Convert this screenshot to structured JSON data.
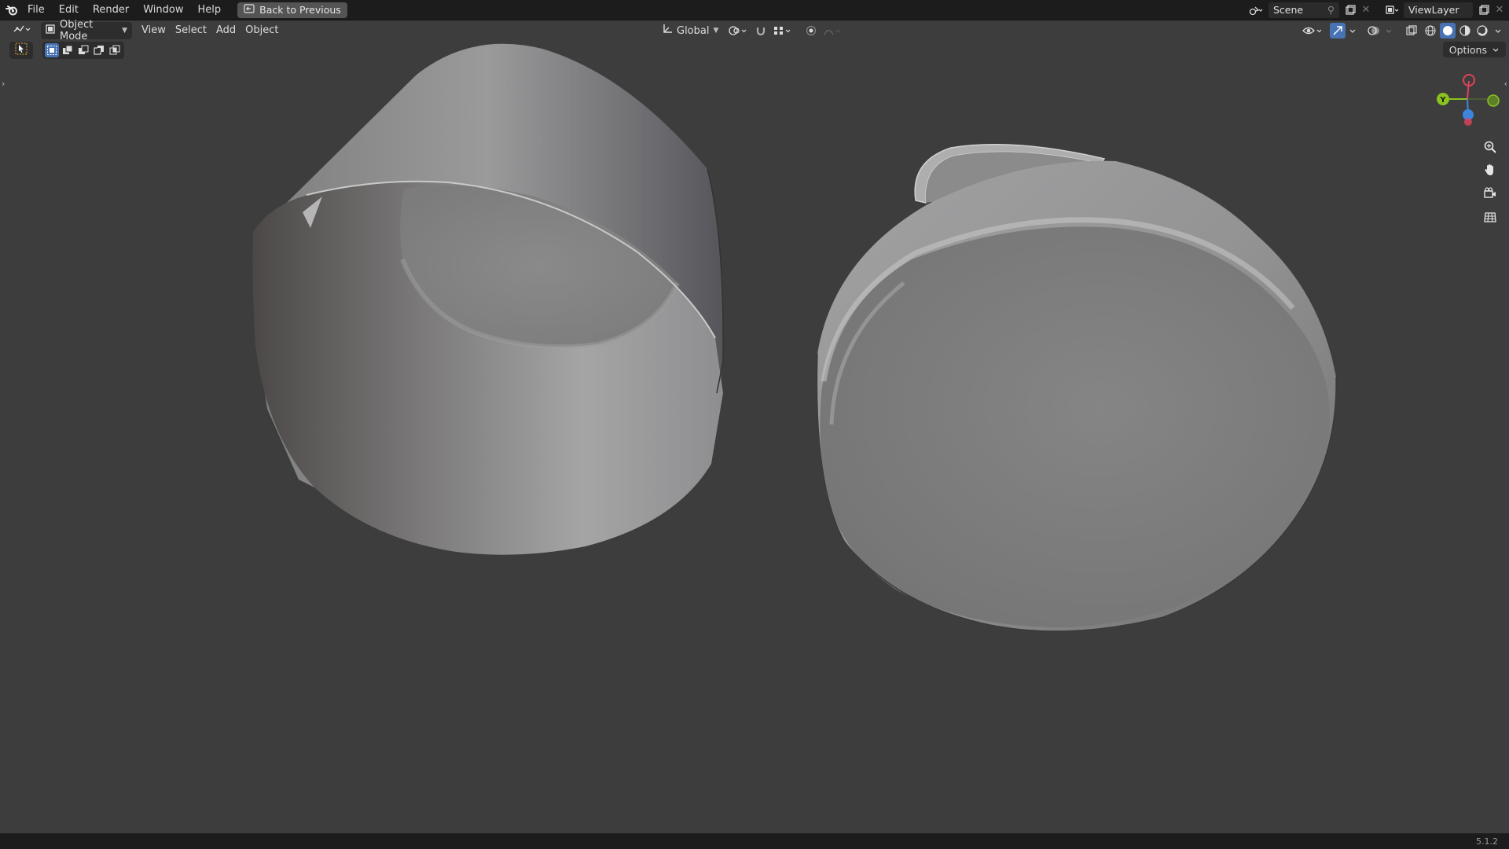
{
  "topbar": {
    "menus": [
      "File",
      "Edit",
      "Render",
      "Window",
      "Help"
    ],
    "back_label": "Back to Previous",
    "scene_name": "Scene",
    "view_layer_name": "ViewLayer"
  },
  "viewport_header": {
    "mode_label": "Object Mode",
    "menus": [
      "View",
      "Select",
      "Add",
      "Object"
    ],
    "orientation_label": "Global",
    "options_label": "Options"
  },
  "gizmo": {
    "y_label": "Y",
    "colors": {
      "x": "#e0425a",
      "y": "#8ac21f",
      "z": "#3d85dd"
    }
  },
  "nav_buttons": [
    "zoom-icon",
    "hand-pan-icon",
    "camera-view-icon",
    "grid-ortho-icon"
  ],
  "status": {
    "version": "5.1.2"
  },
  "theme": {
    "accent": "#4772b3",
    "viewport_bg": "#3d3d3d",
    "bar_bg": "#1c1c1c"
  }
}
